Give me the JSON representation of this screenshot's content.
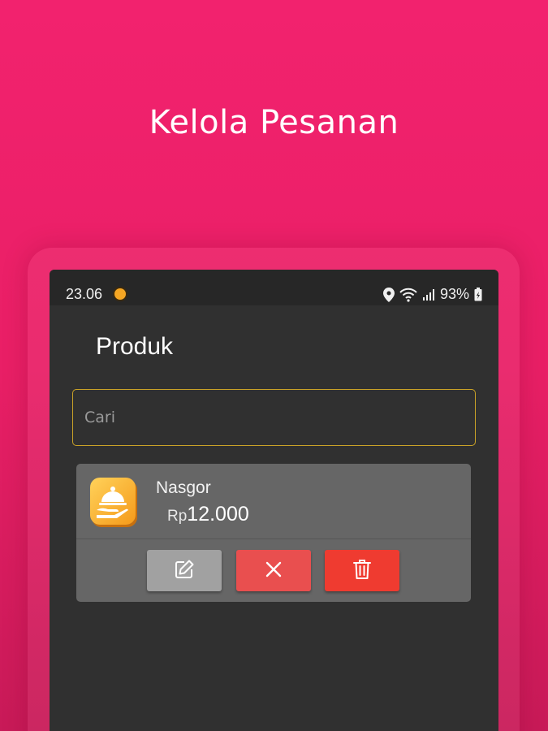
{
  "headline": "Kelola Pesanan",
  "status_bar": {
    "time": "23.06",
    "battery": "93%"
  },
  "app_bar": {
    "title": "Produk"
  },
  "search": {
    "placeholder": "Cari",
    "value": ""
  },
  "product": {
    "name": "Nasgor",
    "currency": "Rp",
    "price": "12.000",
    "icon": "food-cloche-icon"
  },
  "actions": [
    {
      "name": "edit",
      "icon": "edit-icon"
    },
    {
      "name": "close",
      "icon": "close-icon"
    },
    {
      "name": "delete",
      "icon": "trash-icon"
    }
  ],
  "colors": {
    "background": "#f2226e",
    "screen": "#303030",
    "card": "#666666",
    "search_border": "#c9a227",
    "edit_button": "#a1a1a1",
    "close_button": "#e94f4f",
    "delete_button": "#ef3b30"
  }
}
